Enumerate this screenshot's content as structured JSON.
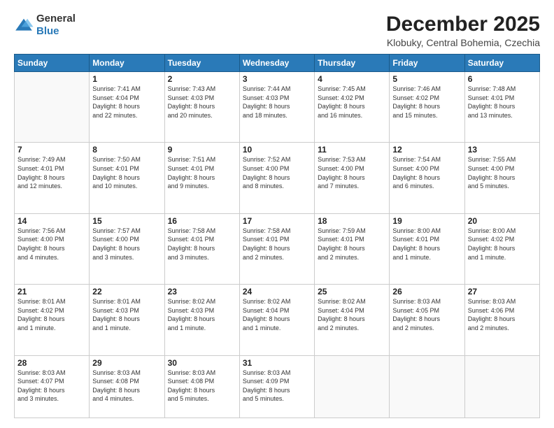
{
  "logo": {
    "general": "General",
    "blue": "Blue"
  },
  "header": {
    "month": "December 2025",
    "location": "Klobuky, Central Bohemia, Czechia"
  },
  "weekdays": [
    "Sunday",
    "Monday",
    "Tuesday",
    "Wednesday",
    "Thursday",
    "Friday",
    "Saturday"
  ],
  "weeks": [
    [
      {
        "day": "",
        "info": ""
      },
      {
        "day": "1",
        "info": "Sunrise: 7:41 AM\nSunset: 4:04 PM\nDaylight: 8 hours\nand 22 minutes."
      },
      {
        "day": "2",
        "info": "Sunrise: 7:43 AM\nSunset: 4:03 PM\nDaylight: 8 hours\nand 20 minutes."
      },
      {
        "day": "3",
        "info": "Sunrise: 7:44 AM\nSunset: 4:03 PM\nDaylight: 8 hours\nand 18 minutes."
      },
      {
        "day": "4",
        "info": "Sunrise: 7:45 AM\nSunset: 4:02 PM\nDaylight: 8 hours\nand 16 minutes."
      },
      {
        "day": "5",
        "info": "Sunrise: 7:46 AM\nSunset: 4:02 PM\nDaylight: 8 hours\nand 15 minutes."
      },
      {
        "day": "6",
        "info": "Sunrise: 7:48 AM\nSunset: 4:01 PM\nDaylight: 8 hours\nand 13 minutes."
      }
    ],
    [
      {
        "day": "7",
        "info": "Sunrise: 7:49 AM\nSunset: 4:01 PM\nDaylight: 8 hours\nand 12 minutes."
      },
      {
        "day": "8",
        "info": "Sunrise: 7:50 AM\nSunset: 4:01 PM\nDaylight: 8 hours\nand 10 minutes."
      },
      {
        "day": "9",
        "info": "Sunrise: 7:51 AM\nSunset: 4:01 PM\nDaylight: 8 hours\nand 9 minutes."
      },
      {
        "day": "10",
        "info": "Sunrise: 7:52 AM\nSunset: 4:00 PM\nDaylight: 8 hours\nand 8 minutes."
      },
      {
        "day": "11",
        "info": "Sunrise: 7:53 AM\nSunset: 4:00 PM\nDaylight: 8 hours\nand 7 minutes."
      },
      {
        "day": "12",
        "info": "Sunrise: 7:54 AM\nSunset: 4:00 PM\nDaylight: 8 hours\nand 6 minutes."
      },
      {
        "day": "13",
        "info": "Sunrise: 7:55 AM\nSunset: 4:00 PM\nDaylight: 8 hours\nand 5 minutes."
      }
    ],
    [
      {
        "day": "14",
        "info": "Sunrise: 7:56 AM\nSunset: 4:00 PM\nDaylight: 8 hours\nand 4 minutes."
      },
      {
        "day": "15",
        "info": "Sunrise: 7:57 AM\nSunset: 4:00 PM\nDaylight: 8 hours\nand 3 minutes."
      },
      {
        "day": "16",
        "info": "Sunrise: 7:58 AM\nSunset: 4:01 PM\nDaylight: 8 hours\nand 3 minutes."
      },
      {
        "day": "17",
        "info": "Sunrise: 7:58 AM\nSunset: 4:01 PM\nDaylight: 8 hours\nand 2 minutes."
      },
      {
        "day": "18",
        "info": "Sunrise: 7:59 AM\nSunset: 4:01 PM\nDaylight: 8 hours\nand 2 minutes."
      },
      {
        "day": "19",
        "info": "Sunrise: 8:00 AM\nSunset: 4:01 PM\nDaylight: 8 hours\nand 1 minute."
      },
      {
        "day": "20",
        "info": "Sunrise: 8:00 AM\nSunset: 4:02 PM\nDaylight: 8 hours\nand 1 minute."
      }
    ],
    [
      {
        "day": "21",
        "info": "Sunrise: 8:01 AM\nSunset: 4:02 PM\nDaylight: 8 hours\nand 1 minute."
      },
      {
        "day": "22",
        "info": "Sunrise: 8:01 AM\nSunset: 4:03 PM\nDaylight: 8 hours\nand 1 minute."
      },
      {
        "day": "23",
        "info": "Sunrise: 8:02 AM\nSunset: 4:03 PM\nDaylight: 8 hours\nand 1 minute."
      },
      {
        "day": "24",
        "info": "Sunrise: 8:02 AM\nSunset: 4:04 PM\nDaylight: 8 hours\nand 1 minute."
      },
      {
        "day": "25",
        "info": "Sunrise: 8:02 AM\nSunset: 4:04 PM\nDaylight: 8 hours\nand 2 minutes."
      },
      {
        "day": "26",
        "info": "Sunrise: 8:03 AM\nSunset: 4:05 PM\nDaylight: 8 hours\nand 2 minutes."
      },
      {
        "day": "27",
        "info": "Sunrise: 8:03 AM\nSunset: 4:06 PM\nDaylight: 8 hours\nand 2 minutes."
      }
    ],
    [
      {
        "day": "28",
        "info": "Sunrise: 8:03 AM\nSunset: 4:07 PM\nDaylight: 8 hours\nand 3 minutes."
      },
      {
        "day": "29",
        "info": "Sunrise: 8:03 AM\nSunset: 4:08 PM\nDaylight: 8 hours\nand 4 minutes."
      },
      {
        "day": "30",
        "info": "Sunrise: 8:03 AM\nSunset: 4:08 PM\nDaylight: 8 hours\nand 5 minutes."
      },
      {
        "day": "31",
        "info": "Sunrise: 8:03 AM\nSunset: 4:09 PM\nDaylight: 8 hours\nand 5 minutes."
      },
      {
        "day": "",
        "info": ""
      },
      {
        "day": "",
        "info": ""
      },
      {
        "day": "",
        "info": ""
      }
    ]
  ]
}
